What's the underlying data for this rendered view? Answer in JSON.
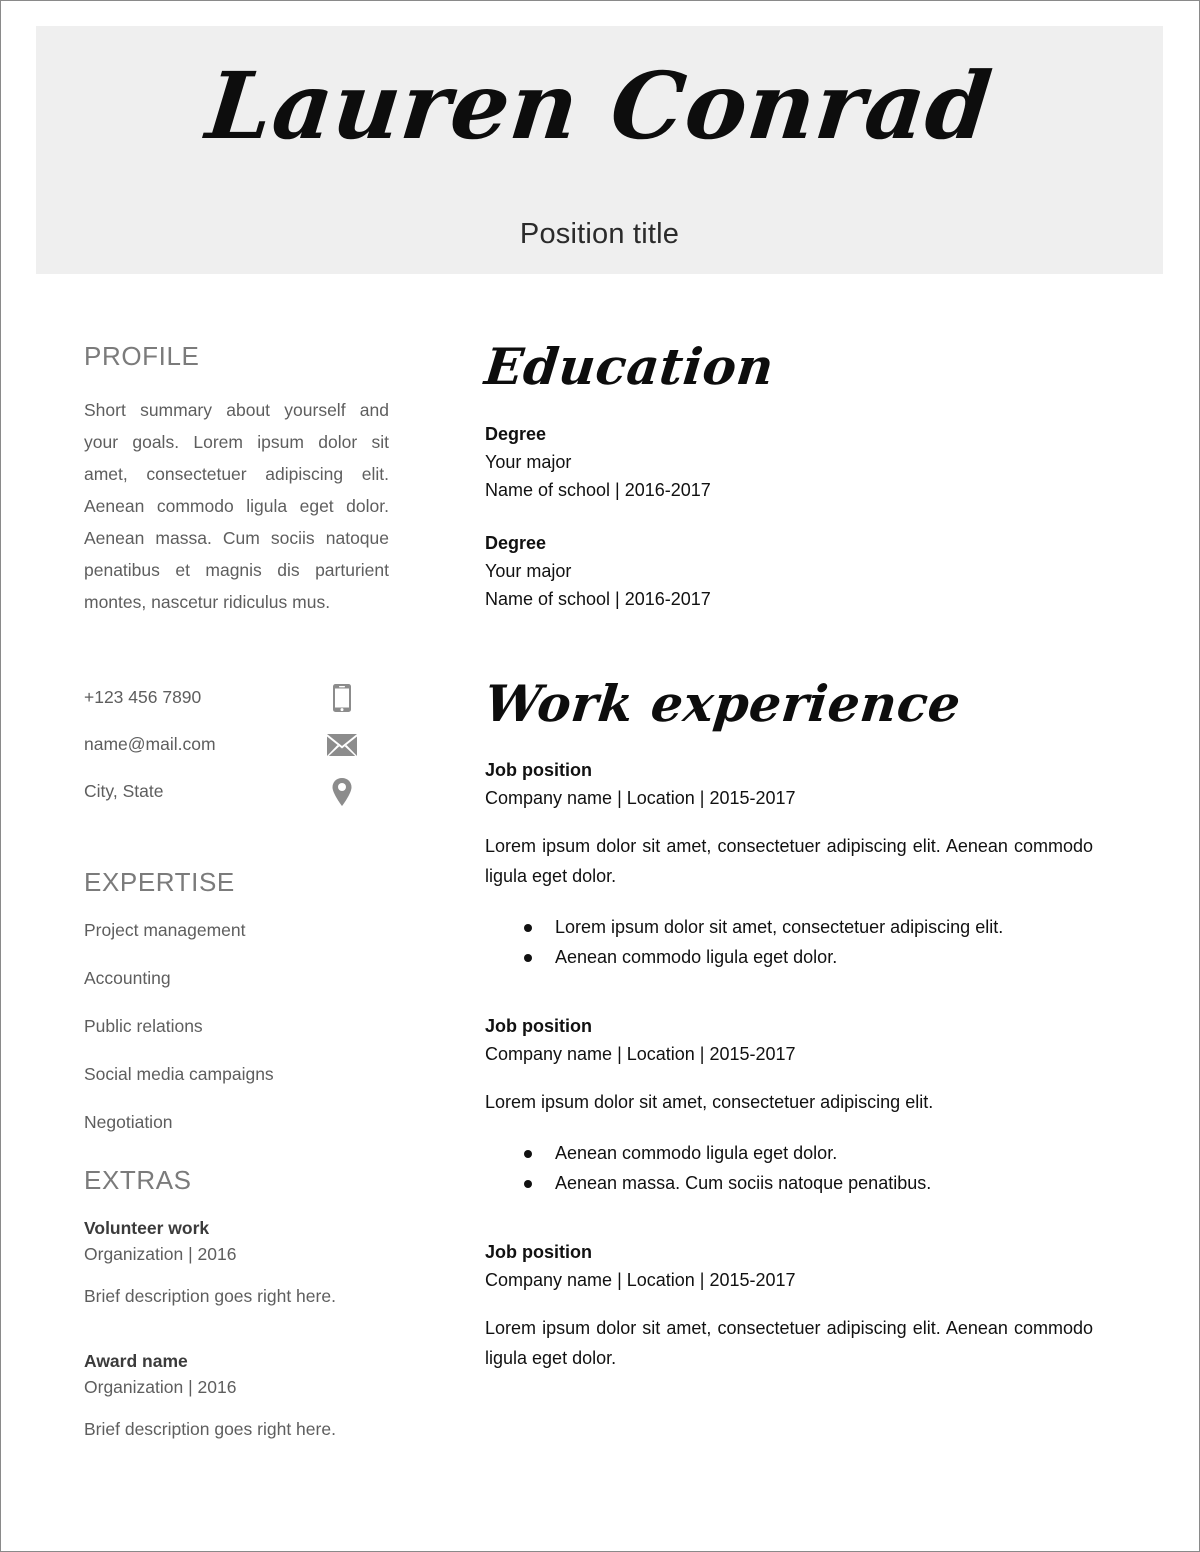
{
  "header": {
    "name": "Lauren Conrad",
    "position_title": "Position title",
    "band_color": "#efefef"
  },
  "sidebar": {
    "profile": {
      "heading": "PROFILE",
      "text": "Short summary about yourself and your goals. Lorem ipsum dolor sit amet, consectetuer adipiscing elit. Aenean commodo ligula eget dolor. Aenean massa. Cum sociis natoque penatibus et magnis dis parturient montes, nascetur ridiculus mus."
    },
    "contact": [
      {
        "value": "+123 456 7890",
        "icon": "phone-icon"
      },
      {
        "value": "name@mail.com",
        "icon": "envelope-icon"
      },
      {
        "value": "City, State",
        "icon": "map-pin-icon"
      }
    ],
    "expertise": {
      "heading": "EXPERTISE",
      "items": [
        "Project management",
        "Accounting",
        "Public relations",
        "Social media campaigns",
        "Negotiation"
      ]
    },
    "extras": {
      "heading": "EXTRAS",
      "entries": [
        {
          "title": "Volunteer work",
          "organization": "Organization | 2016",
          "description": "Brief description goes right here."
        },
        {
          "title": "Award name",
          "organization": "Organization | 2016",
          "description": "Brief description goes right here."
        }
      ]
    }
  },
  "main": {
    "education": {
      "heading": "Education",
      "entries": [
        {
          "degree": "Degree",
          "major": "Your major",
          "school": "Name of school | 2016-2017"
        },
        {
          "degree": "Degree",
          "major": "Your major",
          "school": "Name of school | 2016-2017"
        }
      ]
    },
    "work": {
      "heading": "Work experience",
      "jobs": [
        {
          "position": "Job position",
          "meta": "Company name | Location | 2015-2017",
          "description": "Lorem ipsum dolor sit amet, consectetuer adipiscing elit. Aenean commodo ligula eget dolor.",
          "bullets": [
            "Lorem ipsum dolor sit amet, consectetuer adipiscing elit.",
            "Aenean commodo ligula eget dolor."
          ]
        },
        {
          "position": "Job position",
          "meta": "Company name | Location | 2015-2017",
          "description": "Lorem ipsum dolor sit amet, consectetuer adipiscing elit.",
          "bullets": [
            "Aenean commodo ligula eget dolor.",
            "Aenean massa. Cum sociis natoque penatibus."
          ]
        },
        {
          "position": "Job position",
          "meta": "Company name | Location | 2015-2017",
          "description": "Lorem ipsum dolor sit amet, consectetuer adipiscing elit. Aenean commodo ligula eget dolor.",
          "bullets": []
        }
      ]
    }
  }
}
